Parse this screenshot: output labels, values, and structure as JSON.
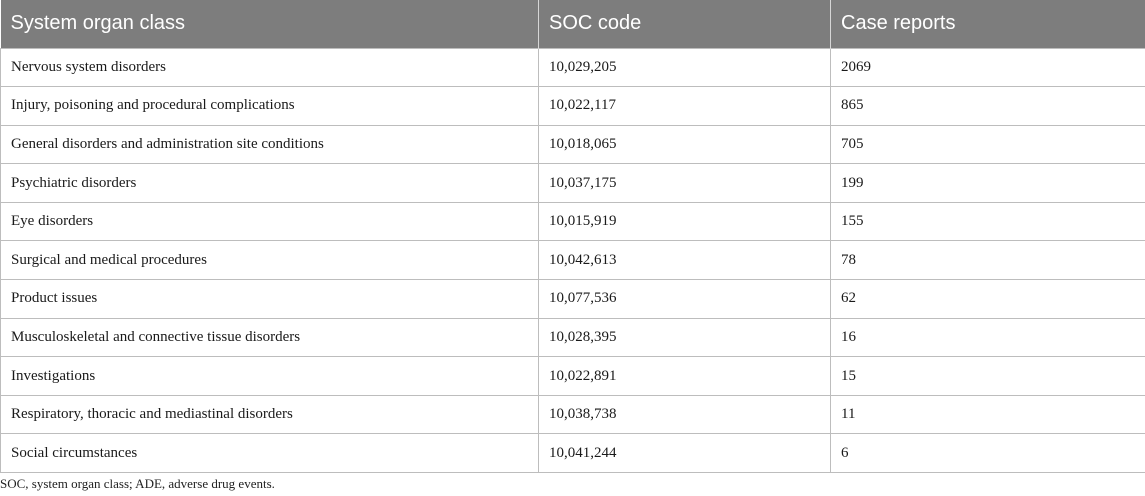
{
  "table": {
    "headers": [
      "System organ class",
      "SOC code",
      "Case reports"
    ],
    "rows": [
      [
        "Nervous system disorders",
        "10,029,205",
        "2069"
      ],
      [
        "Injury, poisoning and procedural complications",
        "10,022,117",
        "865"
      ],
      [
        "General disorders and administration site conditions",
        "10,018,065",
        "705"
      ],
      [
        "Psychiatric disorders",
        "10,037,175",
        "199"
      ],
      [
        "Eye disorders",
        "10,015,919",
        "155"
      ],
      [
        "Surgical and medical procedures",
        "10,042,613",
        "78"
      ],
      [
        "Product issues",
        "10,077,536",
        "62"
      ],
      [
        "Musculoskeletal and connective tissue disorders",
        "10,028,395",
        "16"
      ],
      [
        "Investigations",
        "10,022,891",
        "15"
      ],
      [
        "Respiratory, thoracic and mediastinal disorders",
        "10,038,738",
        "11"
      ],
      [
        "Social circumstances",
        "10,041,244",
        "6"
      ]
    ]
  },
  "footnote": "SOC, system organ class; ADE, adverse drug events.",
  "colors": {
    "header_bg": "#7d7d7d",
    "header_text": "#ffffff",
    "border": "#bdbdbd"
  }
}
